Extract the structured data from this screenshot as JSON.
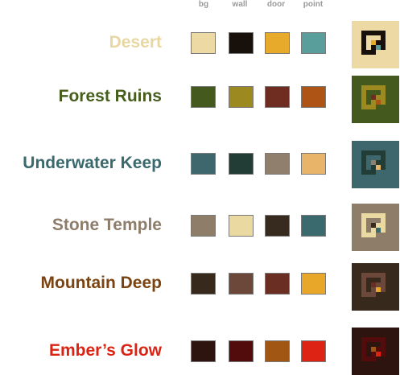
{
  "columns": [
    "bg",
    "wall",
    "door",
    "point"
  ],
  "themes": [
    {
      "name": "Desert",
      "name_color": "#e9d7a1",
      "bg": "#ecd9a3",
      "wall": "#17100b",
      "door": "#e7aa2a",
      "point": "#5a9e9b"
    },
    {
      "name": "Forest Ruins",
      "name_color": "#465d1c",
      "bg": "#44591e",
      "wall": "#9c8a20",
      "door": "#6e2d20",
      "point": "#ae5414"
    },
    {
      "name": "Underwater Keep",
      "name_color": "#3a6a6e",
      "bg": "#3d676c",
      "wall": "#213d36",
      "door": "#8f7f6c",
      "point": "#e8b46a"
    },
    {
      "name": "Stone Temple",
      "name_color": "#8e7d6a",
      "bg": "#8e7d69",
      "wall": "#eadaa2",
      "door": "#372a1e",
      "point": "#3a6a6d"
    },
    {
      "name": "Mountain Deep",
      "name_color": "#7a4412",
      "bg": "#372a1d",
      "wall": "#6b4839",
      "door": "#6a2e22",
      "point": "#e9a72a"
    },
    {
      "name": "Ember’s Glow",
      "name_color": "#db2314",
      "bg": "#2e140f",
      "wall": "#520c0b",
      "door": "#a15613",
      "point": "#dc2314"
    }
  ]
}
